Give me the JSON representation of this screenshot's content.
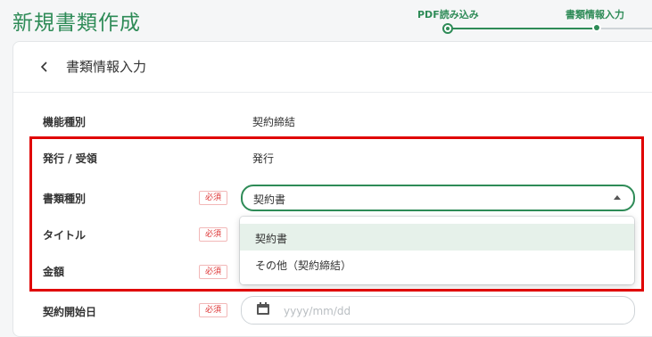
{
  "page": {
    "title": "新規書類作成"
  },
  "stepper": {
    "steps": [
      {
        "label": "PDF読み込み",
        "state": "done"
      },
      {
        "label": "書類情報入力",
        "state": "current"
      }
    ]
  },
  "card": {
    "title": "書類情報入力",
    "back_icon": "chevron-left-icon"
  },
  "form": {
    "function_type": {
      "label": "機能種別",
      "value": "契約締結"
    },
    "issue_receive": {
      "label": "発行 / 受領",
      "value": "発行"
    },
    "document_type": {
      "label": "書類種別",
      "required": "必須",
      "value": "契約書",
      "options": [
        "契約書",
        "その他（契約締結）"
      ],
      "selected_index": 0
    },
    "title": {
      "label": "タイトル",
      "required": "必須"
    },
    "amount": {
      "label": "金額",
      "required": "必須"
    },
    "contract_start": {
      "label": "契約開始日",
      "required": "必須",
      "placeholder": "yyyy/mm/dd"
    }
  },
  "colors": {
    "accent": "#2e8b57",
    "highlight": "#e00000",
    "required": "#dd3333"
  }
}
